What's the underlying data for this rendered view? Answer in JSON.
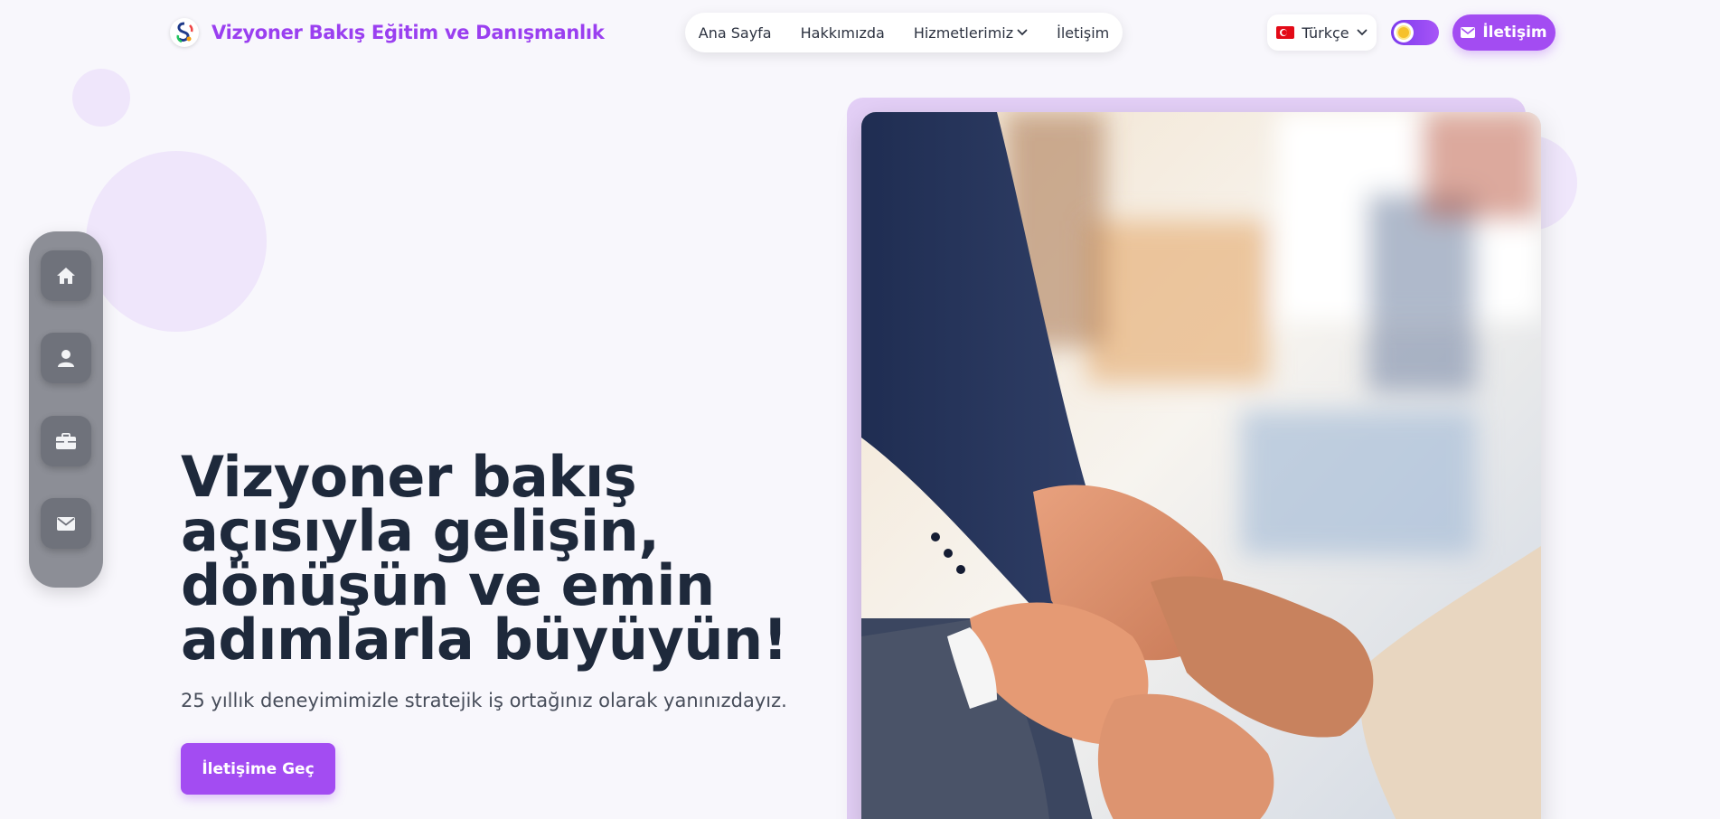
{
  "header": {
    "brand_name": "Vizyoner Bakış Eğitim ve Danışmanlık",
    "nav": [
      {
        "label": "Ana Sayfa"
      },
      {
        "label": "Hakkımızda"
      },
      {
        "label": "Hizmetlerimiz",
        "has_dropdown": true
      },
      {
        "label": "İletişim"
      }
    ],
    "language": {
      "selected": "Türkçe",
      "flag": "turkey-flag"
    },
    "theme_toggle": {
      "state": "light"
    },
    "contact_button": "İletişim"
  },
  "side_dock": [
    {
      "icon": "home-icon"
    },
    {
      "icon": "user-icon"
    },
    {
      "icon": "briefcase-icon"
    },
    {
      "icon": "envelope-icon"
    }
  ],
  "hero": {
    "title": "Vizyoner bakış açısıyla gelişin, dönüşün ve emin adımlarla büyüyün!",
    "subtitle": "25 yıllık deneyimimizle stratejik iş ortağınız olarak yanınızdayız.",
    "cta": "İletişime Geç"
  },
  "colors": {
    "accent": "#a34cf2",
    "brand_text": "#9a3ff0",
    "background": "#f8f7fc",
    "dock": "#8c8e96",
    "frame": "#e3cff6"
  }
}
